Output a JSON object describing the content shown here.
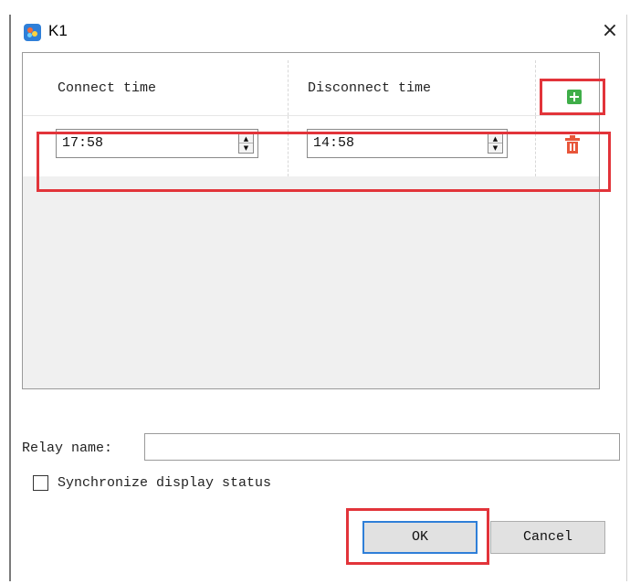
{
  "window": {
    "title": "K1",
    "close_glyph": "×",
    "icon": "app-logo-icon"
  },
  "schedule": {
    "columns": [
      "Connect time",
      "Disconnect time"
    ],
    "add_icon": "plus-icon",
    "rows": [
      {
        "connect": "17:58",
        "disconnect": "14:58",
        "delete_icon": "trash-icon"
      }
    ]
  },
  "relay": {
    "label": "Relay name:",
    "value": ""
  },
  "sync": {
    "label": "Synchronize display status",
    "checked": false
  },
  "buttons": {
    "ok": "OK",
    "cancel": "Cancel"
  },
  "colors": {
    "highlight": "#e2343a",
    "add_green": "#3fae49",
    "delete_red": "#e8563a",
    "focus_blue": "#2f7fd8"
  }
}
